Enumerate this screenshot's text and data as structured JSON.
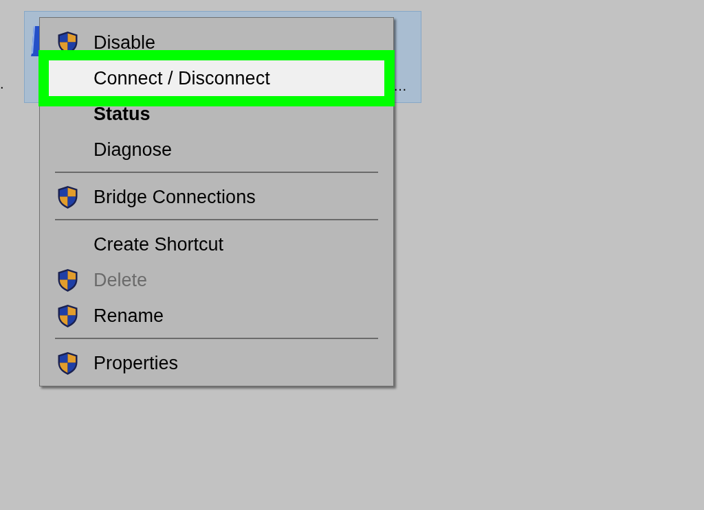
{
  "neighbor_label": ".",
  "adapter_tile": {
    "label": "…",
    "selected": true
  },
  "context_menu": {
    "items": [
      {
        "kind": "item",
        "label": "Disable",
        "has_icon": true,
        "bold": false,
        "disabled": false,
        "selected": false
      },
      {
        "kind": "item",
        "label": "Connect / Disconnect",
        "has_icon": false,
        "bold": false,
        "disabled": false,
        "selected": true
      },
      {
        "kind": "item",
        "label": "Status",
        "has_icon": false,
        "bold": true,
        "disabled": false,
        "selected": false
      },
      {
        "kind": "item",
        "label": "Diagnose",
        "has_icon": false,
        "bold": false,
        "disabled": false,
        "selected": false
      },
      {
        "kind": "separator"
      },
      {
        "kind": "item",
        "label": "Bridge Connections",
        "has_icon": true,
        "bold": false,
        "disabled": false,
        "selected": false
      },
      {
        "kind": "separator"
      },
      {
        "kind": "item",
        "label": "Create Shortcut",
        "has_icon": false,
        "bold": false,
        "disabled": false,
        "selected": false
      },
      {
        "kind": "item",
        "label": "Delete",
        "has_icon": true,
        "bold": false,
        "disabled": true,
        "selected": false
      },
      {
        "kind": "item",
        "label": "Rename",
        "has_icon": true,
        "bold": false,
        "disabled": false,
        "selected": false
      },
      {
        "kind": "separator"
      },
      {
        "kind": "item",
        "label": "Properties",
        "has_icon": true,
        "bold": false,
        "disabled": false,
        "selected": false
      }
    ]
  }
}
